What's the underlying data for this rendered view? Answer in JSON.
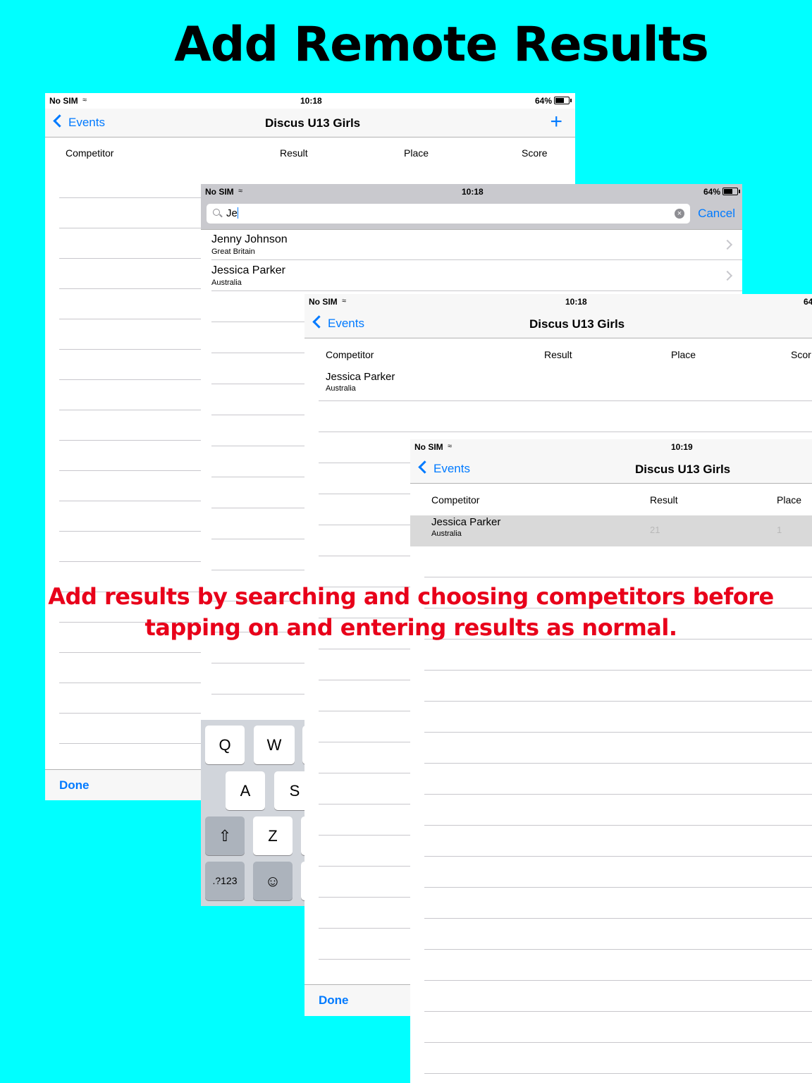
{
  "title": "Add Remote Results",
  "caption": {
    "line1": "Add results by searching and choosing competitors before",
    "line2": "tapping on and entering results as normal."
  },
  "screen1": {
    "status": {
      "carrier": "No SIM",
      "time": "10:18",
      "battery": "64%"
    },
    "back_label": "Events",
    "nav_title": "Discus U13 Girls",
    "add_icon": "plus-icon",
    "headers": [
      "Competitor",
      "Result",
      "Place",
      "Score"
    ],
    "done_label": "Done"
  },
  "screen2": {
    "status": {
      "carrier": "No SIM",
      "time": "10:18",
      "battery": "64%"
    },
    "search": {
      "value": "Je"
    },
    "cancel_label": "Cancel",
    "results": [
      {
        "name": "Jenny Johnson",
        "country": "Great Britain"
      },
      {
        "name": "Jessica Parker",
        "country": "Australia"
      }
    ],
    "keyboard": {
      "row1": [
        "Q",
        "W"
      ],
      "row2": [
        "A",
        "S"
      ],
      "row3": [
        "Z"
      ],
      "numbers_key": ".?123"
    }
  },
  "screen3": {
    "status": {
      "carrier": "No SIM",
      "time": "10:18",
      "battery": "64"
    },
    "back_label": "Events",
    "nav_title": "Discus U13 Girls",
    "headers": [
      "Competitor",
      "Result",
      "Place",
      "Scor"
    ],
    "row": {
      "name": "Jessica Parker",
      "country": "Australia"
    },
    "done_label": "Done"
  },
  "screen4": {
    "status": {
      "carrier": "No SIM",
      "time": "10:19"
    },
    "back_label": "Events",
    "nav_title": "Discus U13 Girls",
    "headers": [
      "Competitor",
      "Result",
      "Place"
    ],
    "row": {
      "name": "Jessica Parker",
      "country": "Australia",
      "result": "21",
      "place": "1"
    }
  }
}
